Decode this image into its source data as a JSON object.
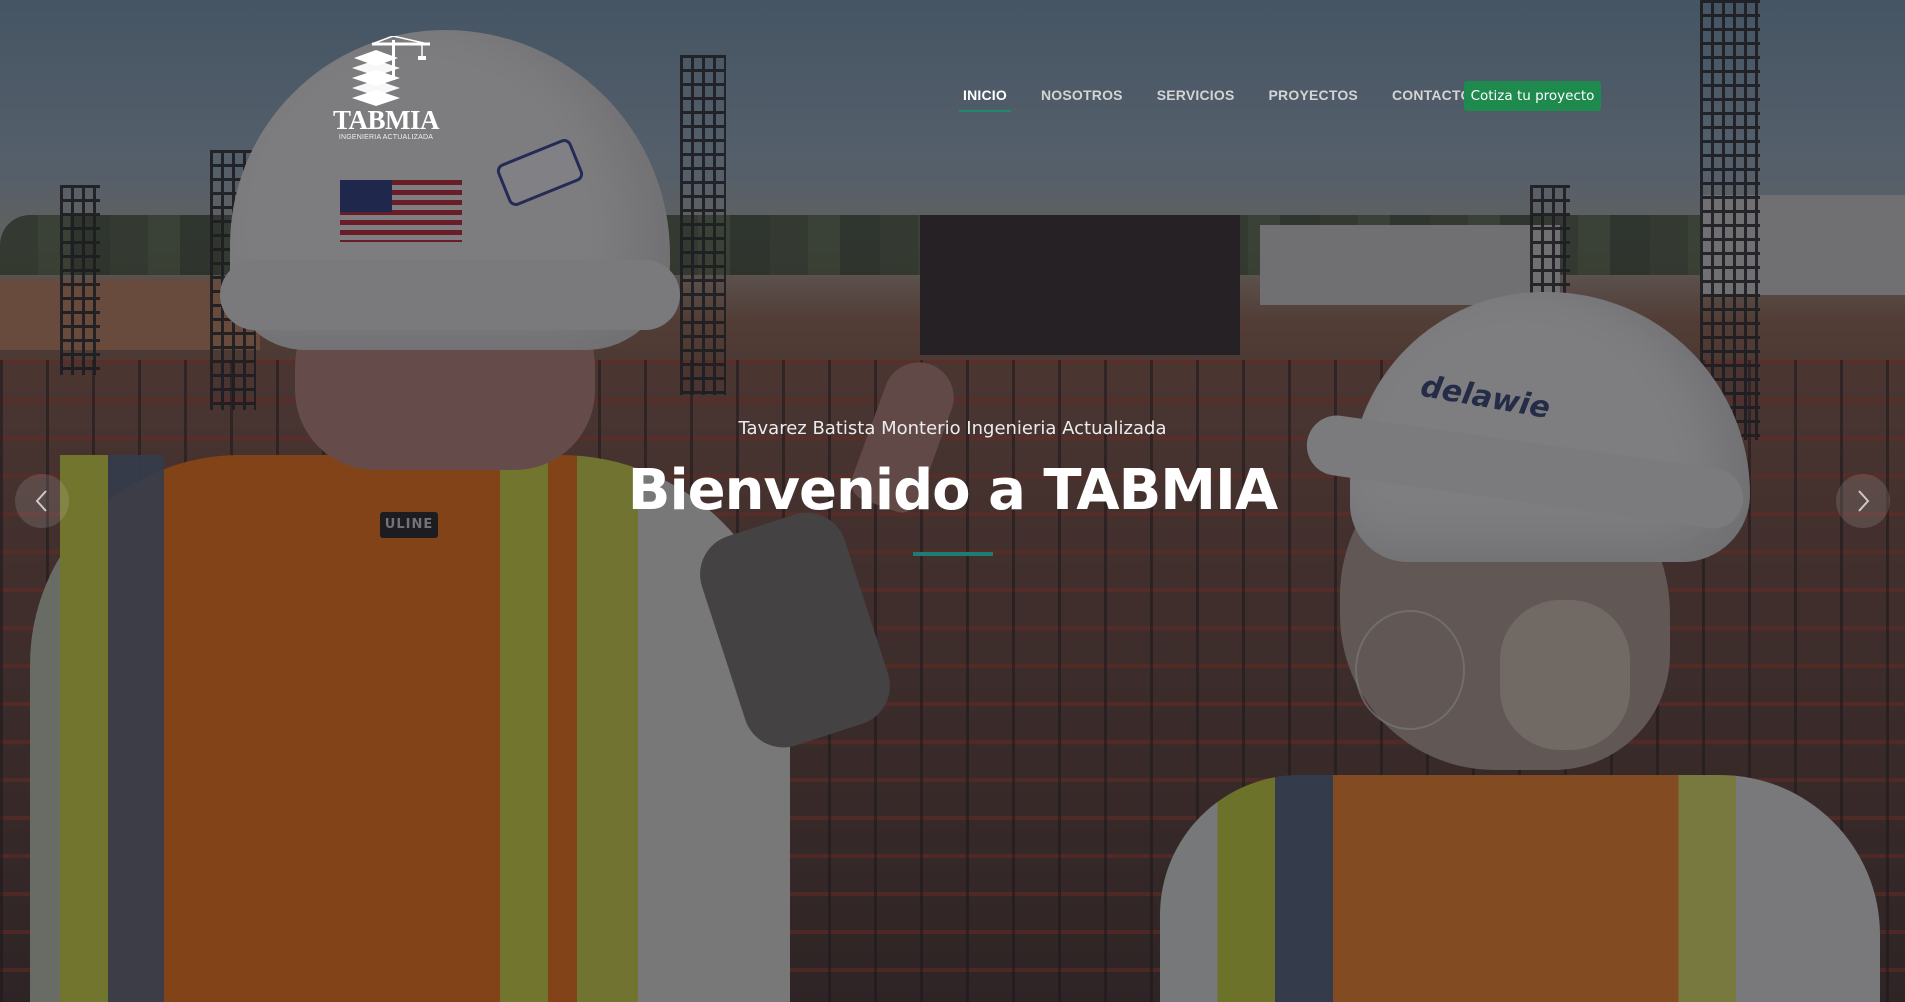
{
  "brand": {
    "name": "TABMIA",
    "tagline": "INGENIERIA ACTUALIZADA"
  },
  "nav": {
    "items": [
      {
        "label": "INICIO",
        "active": true
      },
      {
        "label": "NOSOTROS",
        "active": false
      },
      {
        "label": "SERVICIOS",
        "active": false
      },
      {
        "label": "PROYECTOS",
        "active": false
      },
      {
        "label": "CONTACTO",
        "active": false
      }
    ],
    "cta_label": "Cotiza tu proyecto"
  },
  "hero": {
    "subtitle": "Tavarez Batista Monterio Ingenieria Actualizada",
    "title": "Bienvenido a TABMIA"
  },
  "slider": {
    "prev_icon": "chevron-left-icon",
    "next_icon": "chevron-right-icon"
  },
  "colors": {
    "accent": "#1f8a4e",
    "divider": "#1e7d73"
  }
}
